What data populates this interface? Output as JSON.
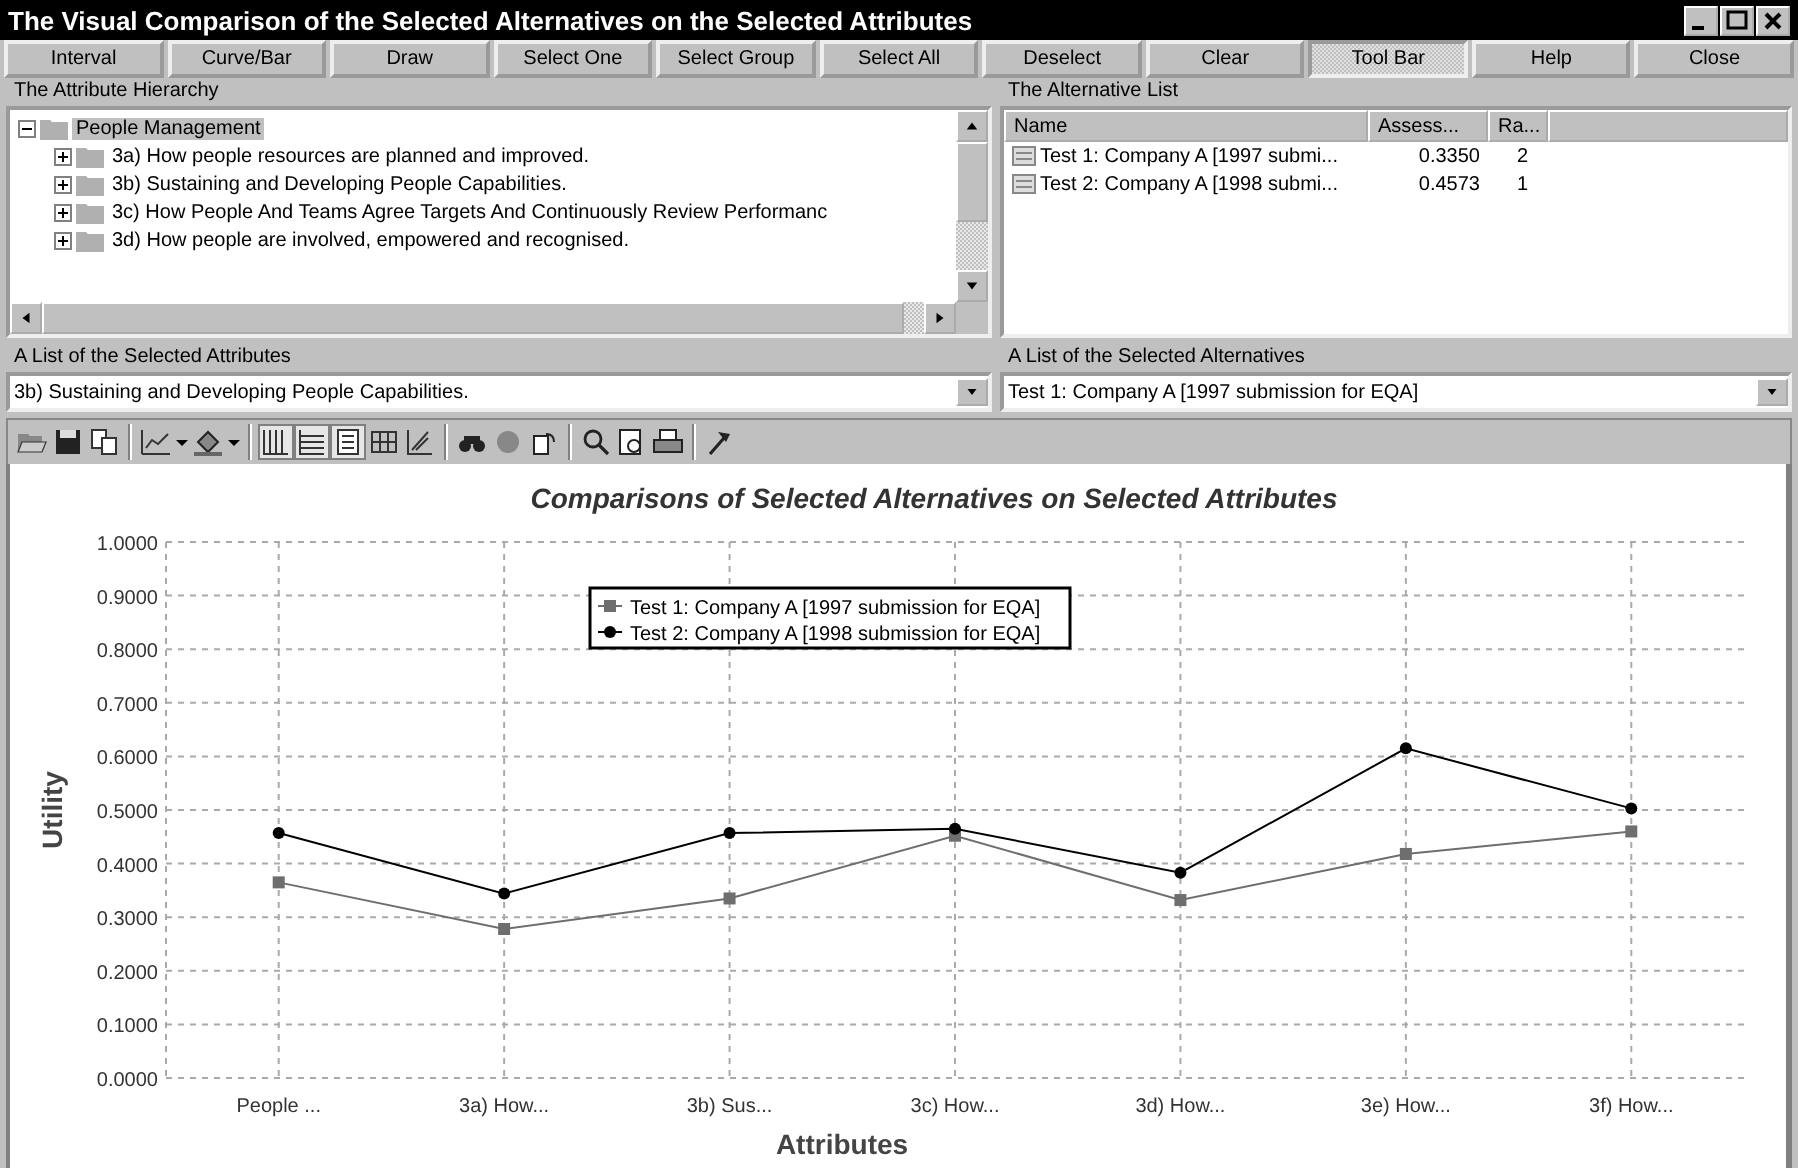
{
  "window": {
    "title": "The Visual Comparison of the Selected Alternatives on the Selected Attributes"
  },
  "buttons": [
    {
      "label": "Interval",
      "pressed": false
    },
    {
      "label": "Curve/Bar",
      "pressed": false
    },
    {
      "label": "Draw",
      "pressed": false
    },
    {
      "label": "Select One",
      "pressed": false
    },
    {
      "label": "Select Group",
      "pressed": false
    },
    {
      "label": "Select All",
      "pressed": false
    },
    {
      "label": "Deselect",
      "pressed": false
    },
    {
      "label": "Clear",
      "pressed": false
    },
    {
      "label": "Tool Bar",
      "pressed": true
    },
    {
      "label": "Help",
      "pressed": false
    },
    {
      "label": "Close",
      "pressed": false
    }
  ],
  "attribute_hierarchy": {
    "label": "The Attribute Hierarchy",
    "tree": [
      {
        "label": "People Management",
        "expanded": true,
        "selected": true,
        "children": [
          {
            "label": "3a) How people resources are planned and improved.",
            "expanded": false,
            "selected": false
          },
          {
            "label": "3b) Sustaining and Developing People Capabilities.",
            "expanded": false,
            "selected": false
          },
          {
            "label": "3c) How People And Teams Agree Targets And Continuously Review Performanc",
            "expanded": false,
            "selected": false
          },
          {
            "label": "3d) How people are involved, empowered and recognised.",
            "expanded": false,
            "selected": false
          }
        ]
      }
    ]
  },
  "alternative_list": {
    "label": "The Alternative List",
    "columns": [
      "Name",
      "Assess...",
      "Ra..."
    ],
    "rows": [
      {
        "name": "Test 1: Company A [1997 submi...",
        "assessment": "0.3350",
        "rank": "2"
      },
      {
        "name": "Test 2: Company A [1998 submi...",
        "assessment": "0.4573",
        "rank": "1"
      }
    ]
  },
  "selected_attributes": {
    "label": "A List of the Selected Attributes",
    "value": "3b) Sustaining and Developing People Capabilities."
  },
  "selected_alternatives": {
    "label": "A List of the Selected Alternatives",
    "value": "Test 1: Company A [1997 submission for EQA]"
  },
  "chart_toolbar": {
    "grid_toggles": [
      {
        "selected": true
      },
      {
        "selected": true
      },
      {
        "selected": true
      },
      {
        "selected": false
      },
      {
        "selected": false
      }
    ]
  },
  "chart": {
    "chart_data": {
      "type": "line",
      "title": "Comparisons of Selected  Alternatives on Selected Attributes",
      "xlabel": "Attributes",
      "ylabel": "Utility",
      "categories": [
        "People ...",
        "3a) How...",
        "3b) Sus...",
        "3c) How...",
        "3d) How...",
        "3e) How...",
        "3f) How..."
      ],
      "grid": true,
      "legend": true,
      "series": [
        {
          "name": "Test 1: Company A [1997 submission for EQA]",
          "color": "#6e6e6e",
          "marker": "square",
          "values": [
            0.365,
            0.278,
            0.335,
            0.452,
            0.332,
            0.418,
            0.46
          ]
        },
        {
          "name": "Test 2: Company A [1998 submission for EQA]",
          "color": "#000000",
          "marker": "circle",
          "values": [
            0.457,
            0.344,
            0.457,
            0.465,
            0.383,
            0.615,
            0.503
          ]
        }
      ],
      "ylim": [
        0,
        1
      ],
      "yticks": [
        {
          "value": 0,
          "label": "0.0000"
        },
        {
          "value": 0.1,
          "label": "0.1000"
        },
        {
          "value": 0.2,
          "label": "0.2000"
        },
        {
          "value": 0.3,
          "label": "0.3000"
        },
        {
          "value": 0.4,
          "label": "0.4000"
        },
        {
          "value": 0.5,
          "label": "0.5000"
        },
        {
          "value": 0.6,
          "label": "0.6000"
        },
        {
          "value": 0.7,
          "label": "0.7000"
        },
        {
          "value": 0.8,
          "label": "0.8000"
        },
        {
          "value": 0.9,
          "label": "0.9000"
        },
        {
          "value": 1,
          "label": "1.0000"
        }
      ]
    }
  }
}
